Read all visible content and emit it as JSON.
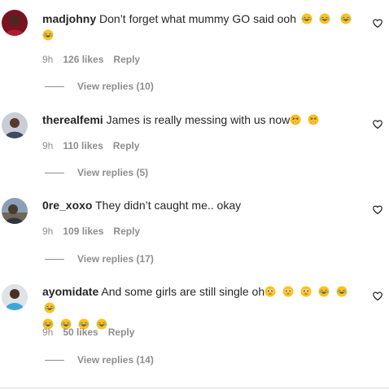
{
  "comments": [
    {
      "username": "madjohny",
      "text": "Don’t forget what mummy GO said ooh",
      "emojis_line1": [
        "laughing-tears",
        "laughing-tears",
        "laughing-tears"
      ],
      "emojis_line2": [
        "laughing-tears"
      ],
      "time": "9h",
      "likes": "126 likes",
      "reply": "Reply",
      "view_replies": "View replies (10)"
    },
    {
      "username": "therealfemi",
      "text": "James is really messing with us now",
      "emojis_line1": [
        "tired-face",
        "tired-face"
      ],
      "time": "9h",
      "likes": "110 likes",
      "reply": "Reply",
      "view_replies": "View replies (5)"
    },
    {
      "username": "0re_xoxo",
      "text": "They didn’t caught me.. okay",
      "time": "9h",
      "likes": "109 likes",
      "reply": "Reply",
      "view_replies": "View replies (17)"
    },
    {
      "username": "ayomidate",
      "text": "And some girls are still single oh",
      "emojis_line1": [
        "pleading-face",
        "pleading-face",
        "pleading-face",
        "laughing-tears",
        "laughing-tears",
        "laughing-tears"
      ],
      "emojis_line2": [
        "laughing-tears",
        "laughing-tears",
        "laughing-tears",
        "laughing-tears"
      ],
      "time": "9h",
      "likes": "50 likes",
      "reply": "Reply",
      "view_replies": "View replies (14)"
    }
  ],
  "icons": {
    "like": "heart-outline-icon"
  },
  "colors": {
    "text": "#262626",
    "secondary": "#8e8e8e",
    "emoji_yellow": "#fcc21b"
  }
}
